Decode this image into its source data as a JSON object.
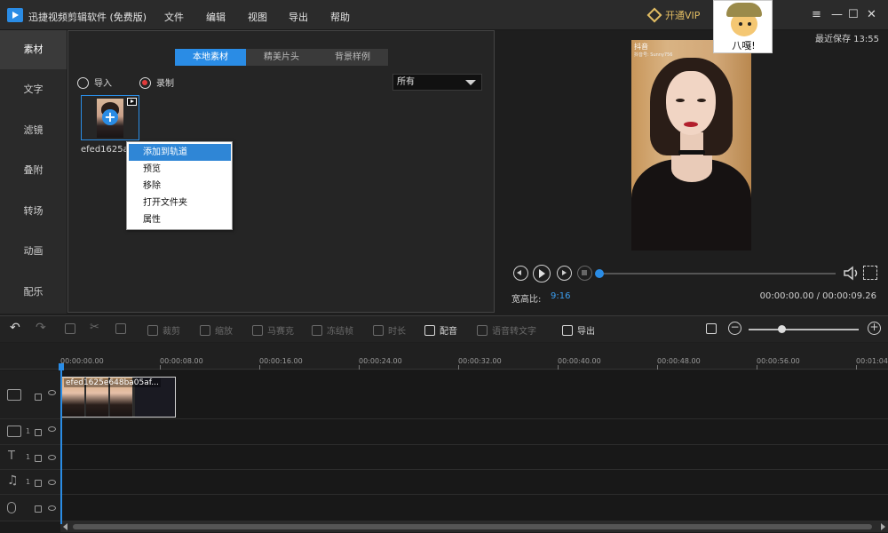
{
  "app": {
    "title": "迅捷视频剪辑软件 (免费版)",
    "vip_label": "开通VIP"
  },
  "menu": [
    "文件",
    "编辑",
    "视图",
    "导出",
    "帮助"
  ],
  "window_controls": [
    "≡",
    "—",
    "☐",
    "✕"
  ],
  "avatar": {
    "label": "八嘎!"
  },
  "sidebar": {
    "items": [
      {
        "label": "素材",
        "active": true
      },
      {
        "label": "文字"
      },
      {
        "label": "滤镜"
      },
      {
        "label": "叠附"
      },
      {
        "label": "转场"
      },
      {
        "label": "动画"
      },
      {
        "label": "配乐"
      }
    ]
  },
  "materials": {
    "tabs": [
      {
        "label": "本地素材",
        "active": true
      },
      {
        "label": "精美片头"
      },
      {
        "label": "背景样例"
      }
    ],
    "import_label": "导入",
    "record_label": "录制",
    "filter_value": "所有",
    "thumb_name": "efed1625a"
  },
  "context_menu": {
    "items": [
      "添加到轨道",
      "预览",
      "移除",
      "打开文件夹",
      "属性"
    ],
    "hovered_index": 0
  },
  "preview": {
    "save_status": "最近保存 13:55",
    "tiktok_label": "抖音",
    "tiktok_sub": "抖音号: Sunny756",
    "aspect_label": "宽高比:",
    "aspect_value": "9:16",
    "time": "00:00:00.00 / 00:00:09.26",
    "progress_percent": 0
  },
  "toolbar": {
    "items": [
      {
        "label": "裁剪",
        "enabled": false
      },
      {
        "label": "缩放",
        "enabled": false
      },
      {
        "label": "马赛克",
        "enabled": false
      },
      {
        "label": "冻结帧",
        "enabled": false
      },
      {
        "label": "时长",
        "enabled": false
      },
      {
        "label": "配音",
        "enabled": true
      },
      {
        "label": "语音转文字",
        "enabled": false
      },
      {
        "label": "导出",
        "enabled": true
      }
    ],
    "zoom_minus": "−",
    "zoom_plus": "+",
    "zoom_percent": 30
  },
  "timeline": {
    "ruler": [
      "00:00:00.00",
      "00:00:08.00",
      "00:00:16.00",
      "00:00:24.00",
      "00:00:32.00",
      "00:00:40.00",
      "00:00:48.00",
      "00:00:56.00",
      "00:01:04"
    ],
    "clip_label": "efed1625e648ba05af...",
    "track_numbers": [
      "1",
      "1",
      "1"
    ]
  },
  "colors": {
    "accent": "#2a8ce5",
    "vip": "#e2bd63",
    "record": "#e23b3b"
  }
}
